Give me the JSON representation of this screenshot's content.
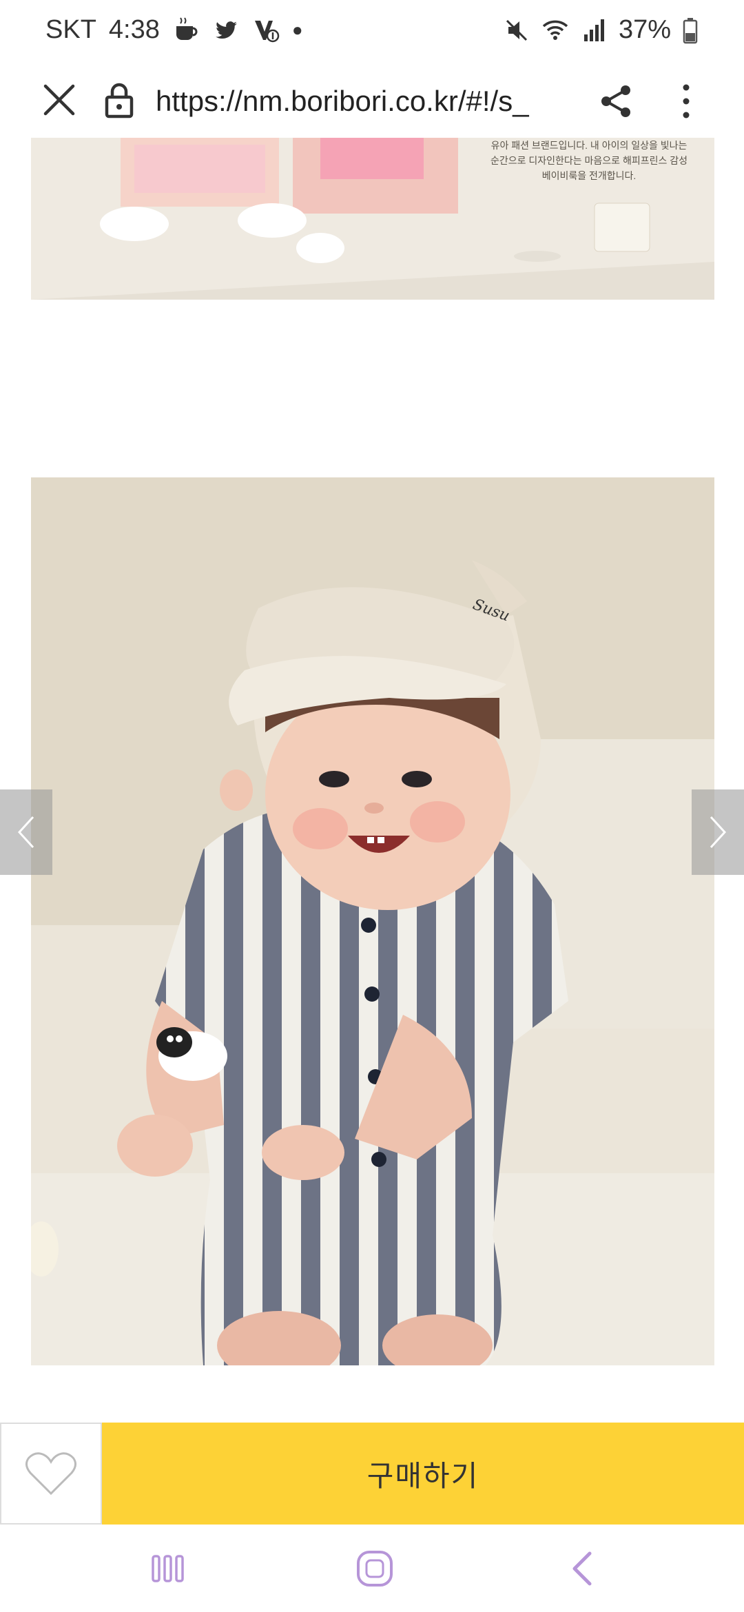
{
  "status_bar": {
    "carrier": "SKT",
    "time": "4:38",
    "battery": "37%",
    "icons": [
      "coffee-icon",
      "twitter-icon",
      "notification-icon",
      "mute-icon",
      "wifi-icon",
      "signal-icon",
      "battery-icon"
    ]
  },
  "browser": {
    "url": "https://nm.boribori.co.kr/#!/s_"
  },
  "content": {
    "top_image_text": "유아 패션 브랜드입니다. 내 아이의 일상을 빛나는 순간으로 디자인한다는 마음으로 해피프린스 감성 베이비룩을 전개합니다."
  },
  "purchase": {
    "buy_label": "구매하기"
  },
  "colors": {
    "buy_button": "#fdd236",
    "nav_arrow": "#969696"
  }
}
